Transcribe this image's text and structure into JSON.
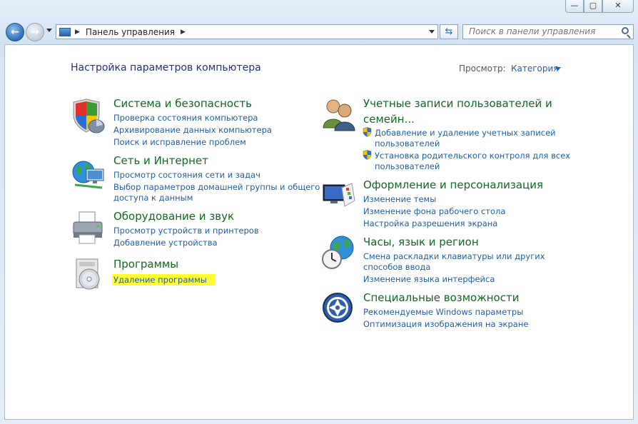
{
  "window": {
    "minimize_label": "—",
    "maximize_label": "▢",
    "close_label": "✕"
  },
  "navbar": {
    "back_icon": "back-arrow-icon",
    "forward_icon": "forward-arrow-icon",
    "breadcrumb": "Панель управления",
    "search_placeholder": "Поиск в панели управления"
  },
  "page": {
    "title": "Настройка параметров компьютера",
    "view_by_label": "Просмотр:",
    "view_by_value": "Категория"
  },
  "categories": {
    "system": {
      "title": "Система и безопасность",
      "icon": "shield-icon",
      "links": [
        "Проверка состояния компьютера",
        "Архивирование данных компьютера",
        "Поиск и исправление проблем"
      ]
    },
    "network": {
      "title": "Сеть и Интернет",
      "icon": "globe-network-icon",
      "links": [
        "Просмотр состояния сети и задач",
        "Выбор параметров домашней группы и общего",
        "доступа к данным"
      ]
    },
    "hardware": {
      "title": "Оборудование и звук",
      "icon": "printer-icon",
      "links": [
        "Просмотр устройств и принтеров",
        "Добавление устройства"
      ]
    },
    "programs": {
      "title": "Программы",
      "icon": "programs-disc-icon",
      "links": [
        "Удаление программы"
      ]
    },
    "users": {
      "title_line1": "Учетные записи пользователей и",
      "title_line2": "семейн...",
      "icon": "users-icon",
      "links": [
        "Добавление и удаление учетных записей",
        "пользователей",
        "Установка родительского контроля для всех",
        "пользователей"
      ]
    },
    "appearance": {
      "title": "Оформление и персонализация",
      "icon": "monitor-palette-icon",
      "links": [
        "Изменение темы",
        "Изменение фона рабочего стола",
        "Настройка разрешения экрана"
      ]
    },
    "clock": {
      "title": "Часы, язык и регион",
      "icon": "clock-globe-icon",
      "links": [
        "Смена раскладки клавиатуры или других",
        "способов ввода",
        "Изменение языка интерфейса"
      ]
    },
    "access": {
      "title": "Специальные возможности",
      "icon": "accessibility-icon",
      "links": [
        "Рекомендуемые Windows параметры",
        "Оптимизация изображения на экране"
      ]
    }
  }
}
